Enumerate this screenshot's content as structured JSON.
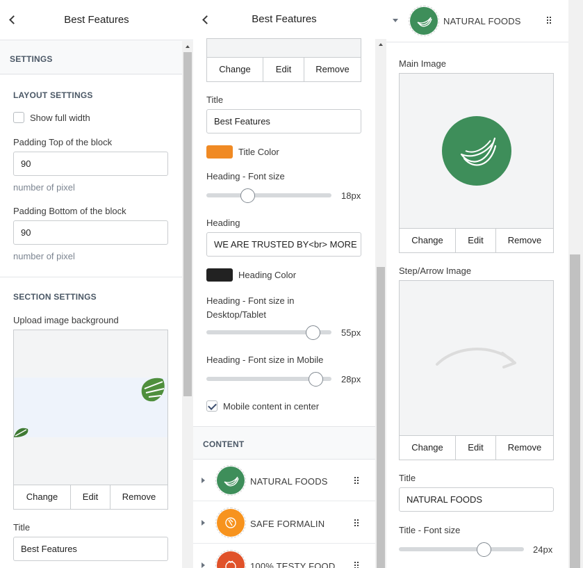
{
  "colors": {
    "green": "#3e8e5a",
    "orange": "#f7931e",
    "red_orange": "#e0522a",
    "title_color": "#f08a24",
    "heading_color": "#222222"
  },
  "panel1": {
    "header_title": "Best Features",
    "settings_heading": "SETTINGS",
    "layout_heading": "LAYOUT SETTINGS",
    "show_full_width": "Show full width",
    "padding_top_label": "Padding Top of the block",
    "padding_top_value": "90",
    "padding_top_help": "number of pixel",
    "padding_bottom_label": "Padding Bottom of the block",
    "padding_bottom_value": "90",
    "padding_bottom_help": "number of pixel",
    "section_heading": "SECTION SETTINGS",
    "upload_label": "Upload image background",
    "btn_change": "Change",
    "btn_edit": "Edit",
    "btn_remove": "Remove",
    "title_label": "Title",
    "title_value": "Best Features"
  },
  "panel2": {
    "header_title": "Best Features",
    "btn_change": "Change",
    "btn_edit": "Edit",
    "btn_remove": "Remove",
    "title_label": "Title",
    "title_value": "Best Features",
    "title_color_label": "Title Color",
    "heading_font_label": "Heading - Font size",
    "heading_font_value": "18px",
    "heading_font_level": 0.33,
    "heading_label": "Heading",
    "heading_value": "WE ARE TRUSTED BY<br> MORE",
    "heading_color_label": "Heading Color",
    "heading_desktop_label": "Heading - Font size in Desktop/Tablet",
    "heading_desktop_value": "55px",
    "heading_desktop_level": 0.85,
    "heading_mobile_label": "Heading - Font size in Mobile",
    "heading_mobile_value": "28px",
    "heading_mobile_level": 0.87,
    "mobile_center_label": "Mobile content in center",
    "content_heading": "CONTENT",
    "items": [
      {
        "name": "NATURAL FOODS",
        "icon": "banana-icon"
      },
      {
        "name": "SAFE FORMALIN",
        "icon": "safe-icon"
      },
      {
        "name": "100% TESTY FOOD",
        "icon": "tomato-icon"
      }
    ]
  },
  "panel3": {
    "item_title": "NATURAL FOODS",
    "main_image_label": "Main Image",
    "btn_change": "Change",
    "btn_edit": "Edit",
    "btn_remove": "Remove",
    "step_image_label": "Step/Arrow Image",
    "title_label": "Title",
    "title_value": "NATURAL FOODS",
    "title_font_label": "Title - Font size",
    "title_font_value": "24px",
    "title_font_level": 0.68
  }
}
